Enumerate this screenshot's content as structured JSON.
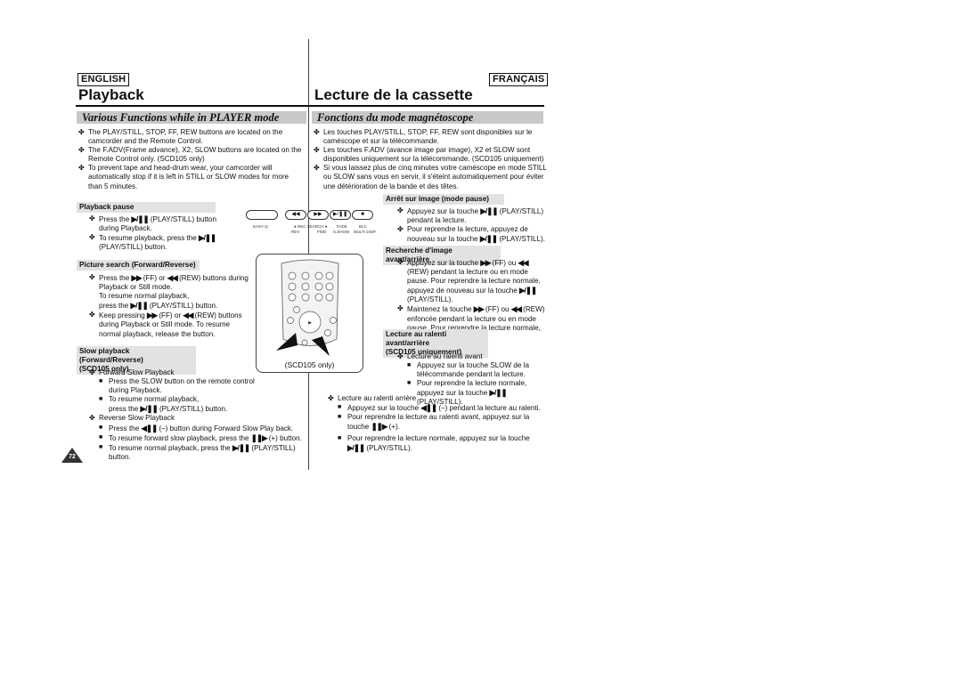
{
  "left": {
    "lang": "ENGLISH",
    "title": "Playback",
    "section": "Various Functions while in PLAYER mode",
    "intro": [
      "The PLAY/STILL, STOP, FF, REW buttons are located on the camcorder and the Remote Control.",
      "The F.ADV(Frame advance), X2, SLOW buttons are located on the Remote Control only. (SCD105 only)",
      "To prevent tape and head-drum wear, your camcorder will automatically stop if it is left in STILL or SLOW modes for more than 5 minutes."
    ],
    "pause": {
      "heading": "Playback pause",
      "items": [
        {
          "pre": "Press the",
          "icon": "▶/❚❚",
          "post": "(PLAY/STILL) button during Playback."
        },
        {
          "pre": "To resume playback, press the",
          "icon": "▶/❚❚",
          "post": "(PLAY/STILL) button."
        }
      ]
    },
    "search": {
      "heading": "Picture search (Forward/Reverse)",
      "item1_a": "Press the",
      "ff_icon": "▶▶",
      "item1_b": "(FF) or",
      "rew_icon": "◀◀",
      "item1_c": "(REW) buttons during Playback or Still mode.",
      "item1_d": "To resume normal playback,",
      "item1_e": "press the",
      "play_icon": "▶/❚❚",
      "item1_f": "(PLAY/STILL) button.",
      "item2_a": "Keep pressing",
      "item2_b": "(FF) or",
      "item2_c": "(REW) buttons during Playback or Still mode. To resume normal playback, release the button."
    },
    "slow": {
      "heading_line1": "Slow playback (Forward/Reverse)",
      "heading_line2": "(SCD105 only)",
      "forward_label": "Forward Slow Playback",
      "fwd1": "Press the SLOW button on the remote control during Playback.",
      "fwd2_a": "To resume normal playback,",
      "fwd2_b": "press the",
      "play_icon": "▶/❚❚",
      "fwd2_c": "(PLAY/STILL) button.",
      "reverse_label": "Reverse Slow Playback",
      "rev1_a": "Press the",
      "rev_icon": "◀❚❚",
      "rev1_b": "(–) button during Forward Slow Play back.",
      "rev2_a": "To resume forward slow playback, press the",
      "fwd_icon": "❚❚▶",
      "rev2_b": "(+) button.",
      "rev3_a": "To resume normal playback, press the",
      "rev3_b": "(PLAY/STILL) button."
    },
    "page_number": "72"
  },
  "figure": {
    "buttons": [
      "◀◀",
      "▶▶",
      "▶/❚❚",
      "■"
    ],
    "easy_label": "EASY Q",
    "labels_top": [
      "● REC SEARCH ●",
      "FADE",
      "BLC"
    ],
    "labels_bottom": [
      "REV",
      "FWD",
      "S.SHOW",
      "MULTI DISP."
    ],
    "remote_caption": "(SCD105 only)"
  },
  "right": {
    "lang": "FRANÇAIS",
    "title": "Lecture de la cassette",
    "section": "Fonctions du mode magnétoscope",
    "intro": [
      "Les touches PLAY/STILL, STOP, FF, REW sont disponibles sur le caméscope et sur la télécommande.",
      "Les touches F.ADV (avance image par image), X2 et SLOW sont disponibles uniquement sur la télécommande. (SCD105 uniquement)",
      "Si vous laissez plus de cinq minutes votre caméscope en mode STILL ou SLOW sans vous en servir, il s'éteint automatiquement pour éviter une détérioration de la bande et des têtes."
    ],
    "pause": {
      "heading": "Arrêt sur image (mode pause)",
      "item1_a": "Appuyez sur la touche",
      "item1_b": "(PLAY/STILL) pendant la lecture.",
      "item2_a": "Pour reprendre la lecture, appuyez de nouveau sur la touche",
      "item2_b": "(PLAY/STILL)."
    },
    "search": {
      "heading": "Recherche d'image avant/arrière",
      "item1_a": "Appuyez sur la touche",
      "item1_b": "(FF) ou",
      "item1_c": "(REW) pendant la lecture ou en mode pause.",
      "item1_d": "Pour reprendre la lecture normale, appuyez de nouveau sur la touche",
      "item1_e": "(PLAY/STILL).",
      "item2_a": "Maintenez la touche",
      "item2_b": "(FF) ou",
      "item2_c": "(REW) enfoncée pendant la lecture ou en mode pause. Pour reprendre la lecture normale, relâchez la touche."
    },
    "slow": {
      "heading_line1": "Lecture au ralenti avant/arrière",
      "heading_line2": "(SCD105 uniquement)",
      "forward_label": "Lecture au ralenti avant",
      "fwd1": "Appuyez sur la touche SLOW de la télécommande pendant la lecture.",
      "fwd2_a": "Pour reprendre la lecture normale, appuyez sur la touche",
      "fwd2_b": "(PLAY/STILL).",
      "reverse_label": "Lecture au ralenti arrière",
      "rev1_a": "Appuyez sur la touche",
      "rev1_b": "(–) pendant la lecture au ralenti.",
      "rev2_a": "Pour reprendre la lecture au ralenti avant, appuyez sur la touche",
      "rev2_b": "(+).",
      "rev3_a": "Pour reprendre la lecture normale, appuyez sur la touche",
      "rev3_b": "(PLAY/STILL)."
    }
  },
  "icons": {
    "play_still": "▶/❚❚",
    "ff": "▶▶",
    "rew": "◀◀",
    "slow_rev": "◀❚❚",
    "slow_fwd": "❚❚▶",
    "bullet": "✤",
    "square": "■"
  }
}
